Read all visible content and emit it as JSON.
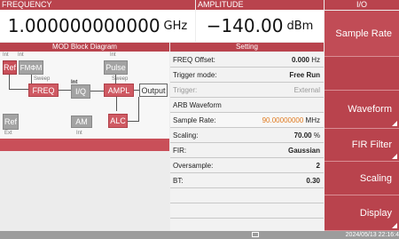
{
  "header": {
    "frequency_label": "FREQUENCY",
    "frequency_value": "1.000000000000",
    "frequency_unit": "GHz",
    "amplitude_label": "AMPLITUDE",
    "amplitude_value": "−140.00",
    "amplitude_unit": "dBm",
    "menu_label": "I/O"
  },
  "diagram": {
    "title": "MOD Block Diagram",
    "int_ref": "Int",
    "int_fm": "Int",
    "int_pulse": "Int",
    "ref": "Ref",
    "fm": "FMΦM",
    "pulse": "Pulse",
    "sweep1": "Sweep",
    "sweep2": "Sweep",
    "freq": "FREQ",
    "int_iq": "Int",
    "iq": "I/Q",
    "ampl": "AMPL",
    "output": "Output",
    "ref_out": "Ref",
    "ext": "Ext",
    "am": "AM",
    "int_am": "Int",
    "alc": "ALC"
  },
  "settings": {
    "title": "Setting",
    "rows": [
      {
        "key": "FREQ Offset:",
        "value": "0.000",
        "unit": "Hz"
      },
      {
        "key": "Trigger mode:",
        "value": "Free Run",
        "unit": ""
      },
      {
        "key": "Trigger:",
        "value": "External",
        "unit": ""
      },
      {
        "key": "ARB Waveform",
        "value": "",
        "unit": ""
      },
      {
        "key": "Sample Rate:",
        "value": "90.00000000",
        "unit": "MHz"
      },
      {
        "key": "Scaling:",
        "value": "70.00",
        "unit": "%"
      },
      {
        "key": "FIR:",
        "value": "Gaussian",
        "unit": ""
      },
      {
        "key": "Oversample:",
        "value": "2",
        "unit": ""
      },
      {
        "key": "BT:",
        "value": "0.30",
        "unit": ""
      }
    ]
  },
  "softkeys": [
    "Sample Rate",
    "",
    "Waveform",
    "FIR Filter",
    "Scaling",
    "Display"
  ],
  "status": {
    "datetime": "2024/05/13 22:16:4"
  },
  "colors": {
    "accent": "#b9434d",
    "highlight_value": "#e07a1f"
  }
}
